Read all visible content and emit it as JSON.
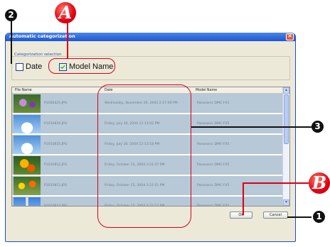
{
  "dialog": {
    "title": "Automatic categorization",
    "close_glyph": "✕"
  },
  "group": {
    "label": "Categorization selection",
    "date_checkbox": {
      "label": "Date",
      "checked": false
    },
    "model_checkbox": {
      "label": "Model Name",
      "checked": true
    }
  },
  "table": {
    "columns": [
      "File Name",
      "Date",
      "Model Name"
    ],
    "rows": [
      {
        "file": "P1000425.JPG",
        "date": "Wednesday, November 26, 2003 2:17:09 PM",
        "model": "Panasonic DMC-FX1",
        "thumb": "flower-purple"
      },
      {
        "file": "P1010826.JPG",
        "date": "Friday, July 30, 2004 12:13:02 PM",
        "model": "Panasonic DMC-FX5",
        "thumb": "sky-clouds"
      },
      {
        "file": "P1010835.JPG",
        "date": "Friday, July 30, 2004 12:13:18 PM",
        "model": "Panasonic DMC-FX5",
        "thumb": "sky-clouds"
      },
      {
        "file": "P1010812.JPG",
        "date": "Friday, October 15, 2004 3:21:27 PM",
        "model": "Panasonic DMC-FX5",
        "thumb": "flower-orange"
      },
      {
        "file": "P1010813.JPG",
        "date": "Friday, October 15, 2004 3:21:51 PM",
        "model": "Panasonic DMC-FX5",
        "thumb": "flower-mixed"
      },
      {
        "file": "P1010814.JPG",
        "date": "Friday, October 15, 2004 3:22:17 PM",
        "model": "Panasonic DMC-FX5",
        "thumb": "sky-tower"
      }
    ]
  },
  "buttons": {
    "ok": "OK",
    "cancel": "Cancel"
  },
  "callouts": {
    "marker_a": "A",
    "marker_b": "B",
    "marker_1": "1",
    "marker_2": "2",
    "marker_3": "3"
  },
  "colors": {
    "callout_red": "#d9001b",
    "row_fill": "#b7c8d6",
    "titlebar_blue": "#1c57d0"
  }
}
